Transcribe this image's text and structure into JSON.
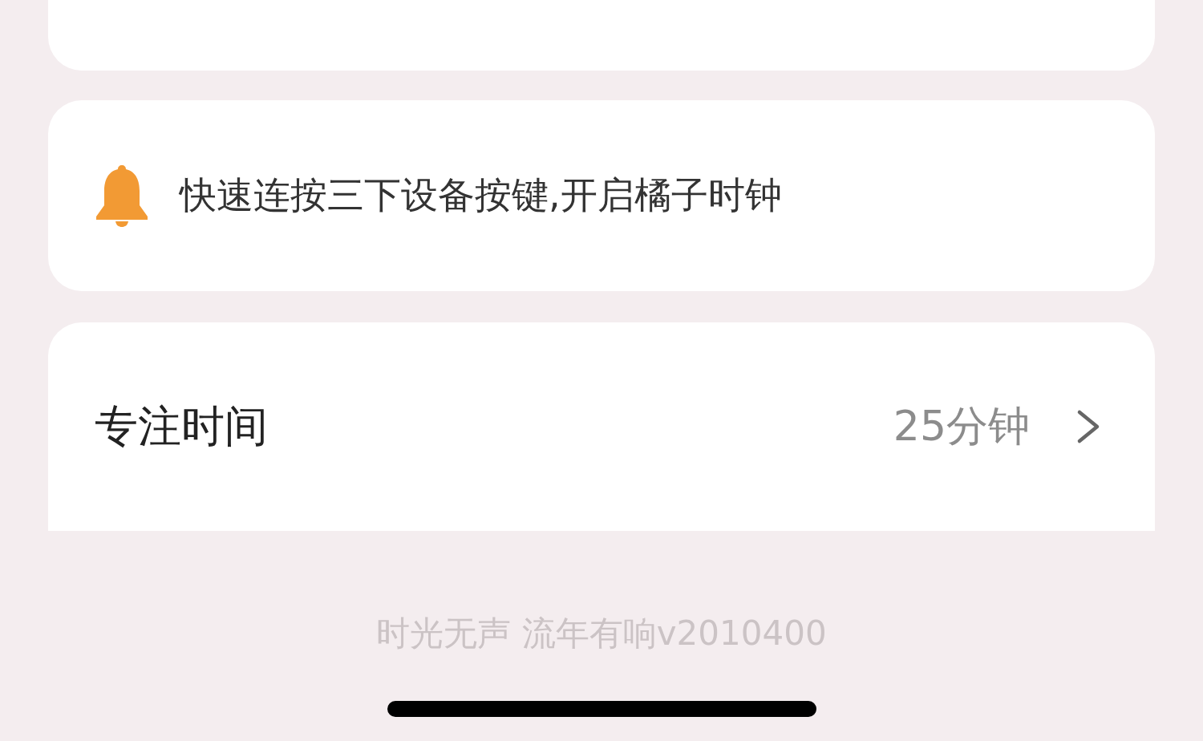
{
  "notice": {
    "text": "快速连按三下设备按键,开启橘子时钟"
  },
  "settings": [
    {
      "label": "专注时间",
      "value": "25分钟"
    }
  ],
  "footer": "时光无声 流年有响v2010400"
}
